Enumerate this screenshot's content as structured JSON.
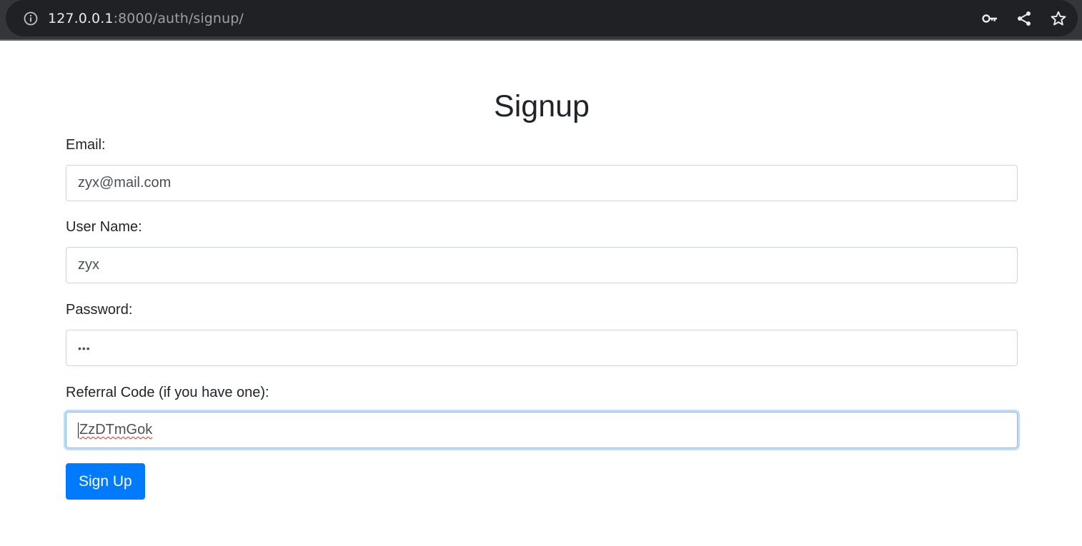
{
  "browser": {
    "url_host": "127.0.0.1",
    "url_rest": ":8000/auth/signup/",
    "icons": [
      "info-icon",
      "key-icon",
      "share-icon",
      "star-icon"
    ]
  },
  "page": {
    "title": "Signup",
    "fields": [
      {
        "label": "Email:",
        "value": "zyx@mail.com",
        "type": "email"
      },
      {
        "label": "User Name:",
        "value": "zyx",
        "type": "text"
      },
      {
        "label": "Password:",
        "value": "•••",
        "type": "password"
      },
      {
        "label": "Referral Code (if you have one):",
        "value": "ZzDTmGok",
        "type": "text",
        "focused": true
      }
    ],
    "submit_label": "Sign Up"
  },
  "colors": {
    "primary": "#007bff",
    "focus_border": "#80bdff",
    "text": "#212529",
    "chrome_bg": "#202124"
  }
}
